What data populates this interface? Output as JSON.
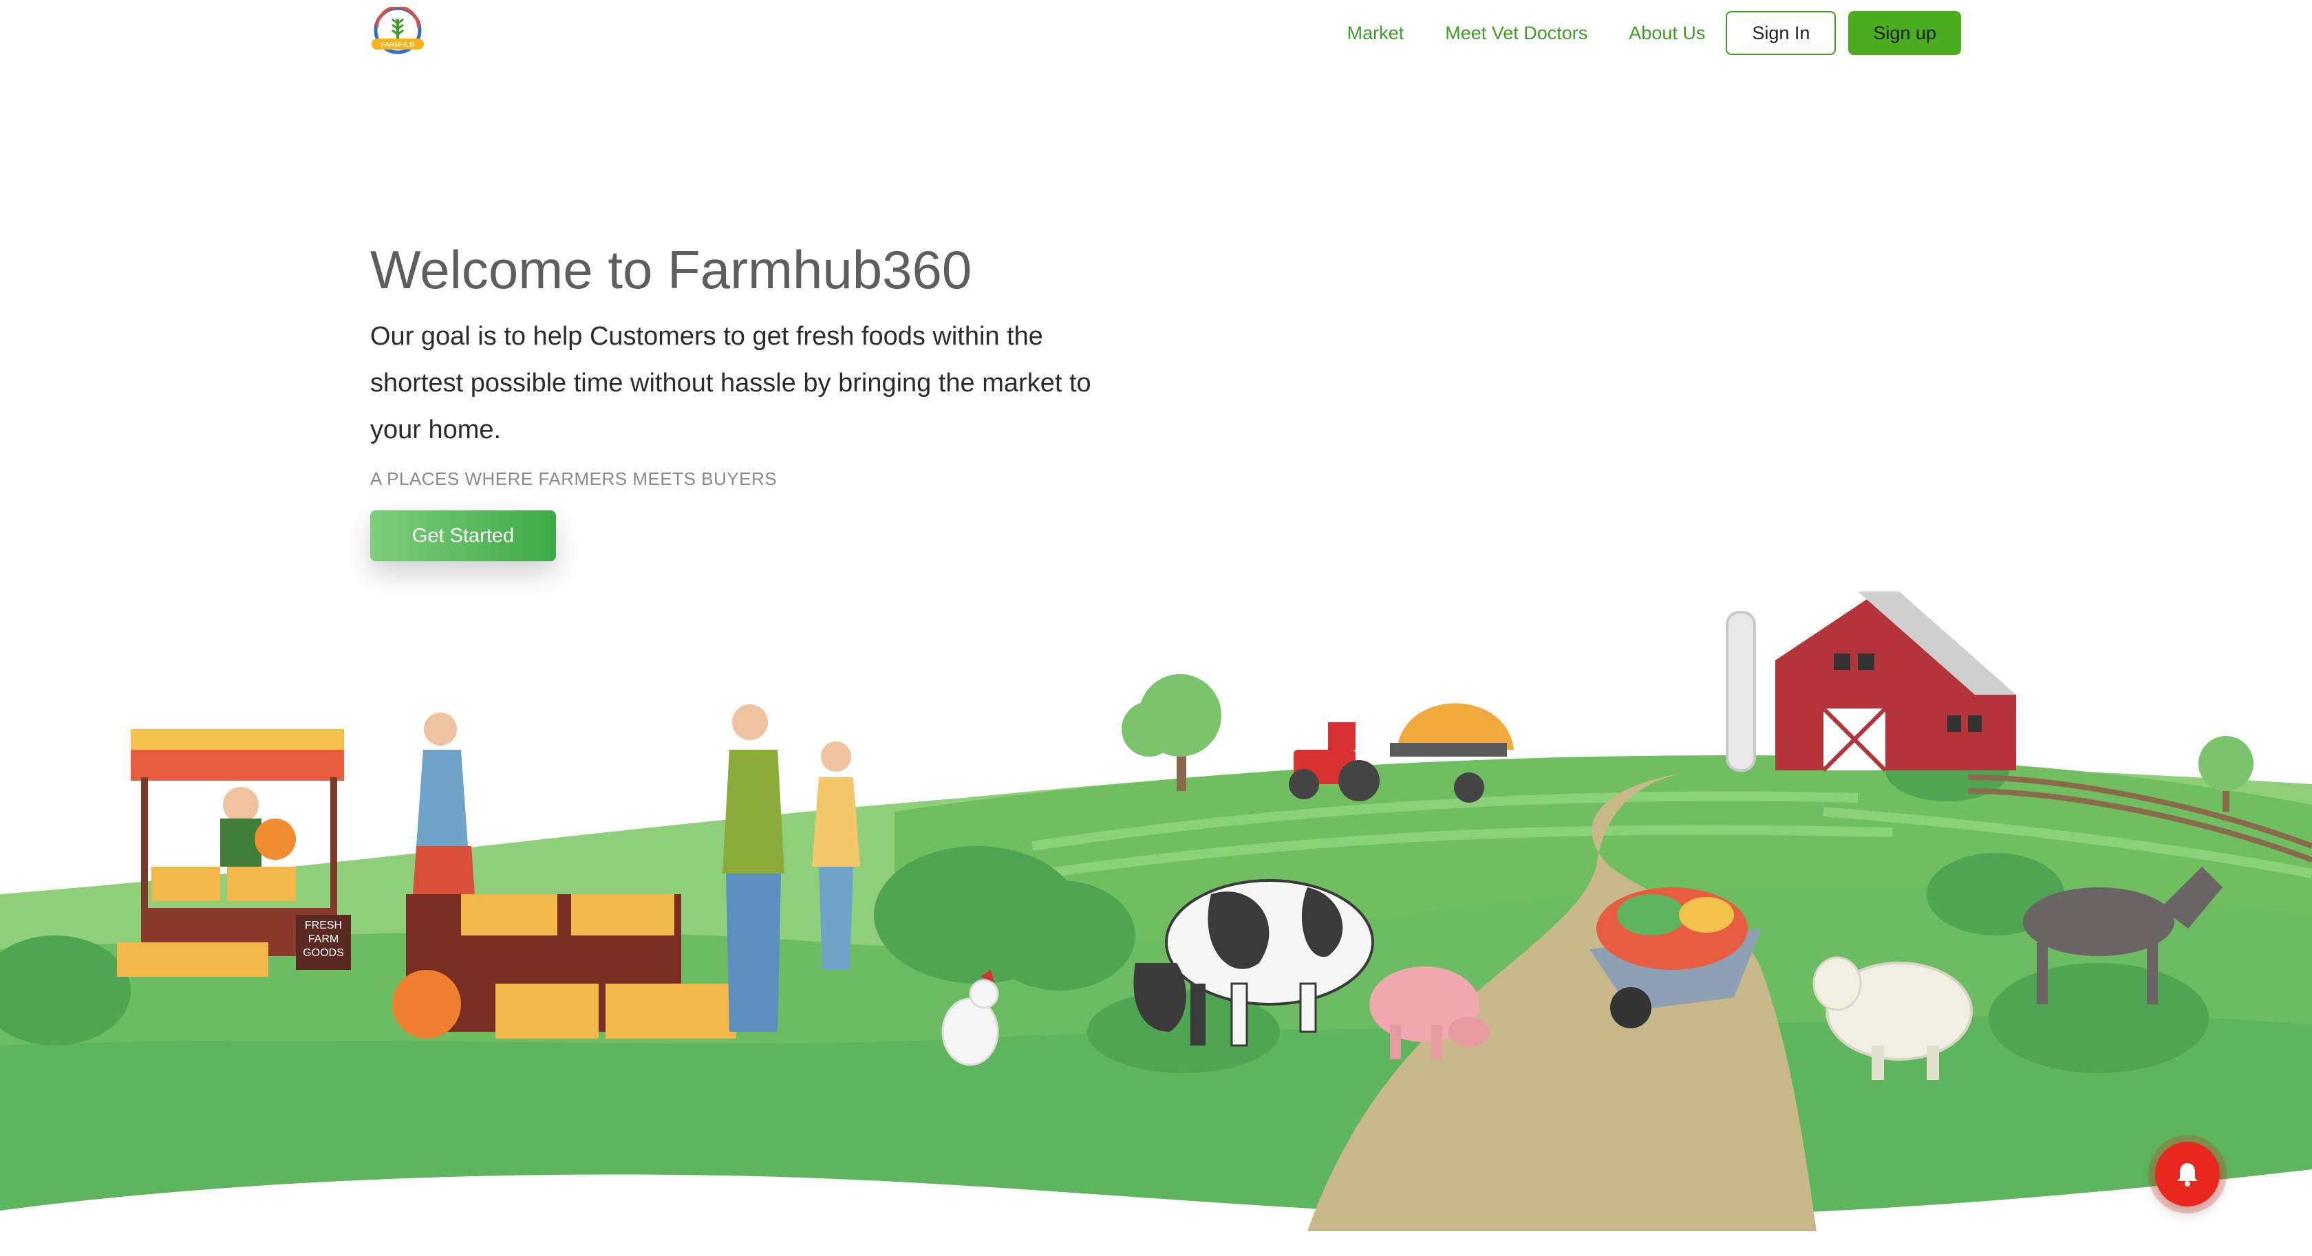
{
  "brand": {
    "logo_text": "FARMHUB",
    "logo_icon": "wheat-logo-icon",
    "primary_color": "#3f9c25",
    "accent_color": "#4aad1f"
  },
  "nav": {
    "links": [
      "Market",
      "Meet Vet Doctors",
      "About Us"
    ],
    "signin_label": "Sign In",
    "signup_label": "Sign up"
  },
  "hero": {
    "title": "Welcome to Farmhub360",
    "description": "Our goal is to help Customers to get fresh foods within the shortest possible time without hassle by bringing the market to your home.",
    "tagline": "A PLACES WHERE FARMERS MEETS BUYERS",
    "cta_label": "Get Started",
    "cta_colors": [
      "#7fce7d",
      "#3daa45"
    ]
  },
  "illustration": {
    "stall_sign": [
      "FRESH",
      "FARM",
      "GOODS"
    ],
    "sky_color": "#ffffff",
    "grass_colors": [
      "#5db55e",
      "#7cc46c",
      "#8fcf7a"
    ],
    "path_color": "#c9b98a",
    "barn_color": "#b5333a"
  },
  "notification": {
    "icon": "bell-icon",
    "color": "#e9271c"
  }
}
